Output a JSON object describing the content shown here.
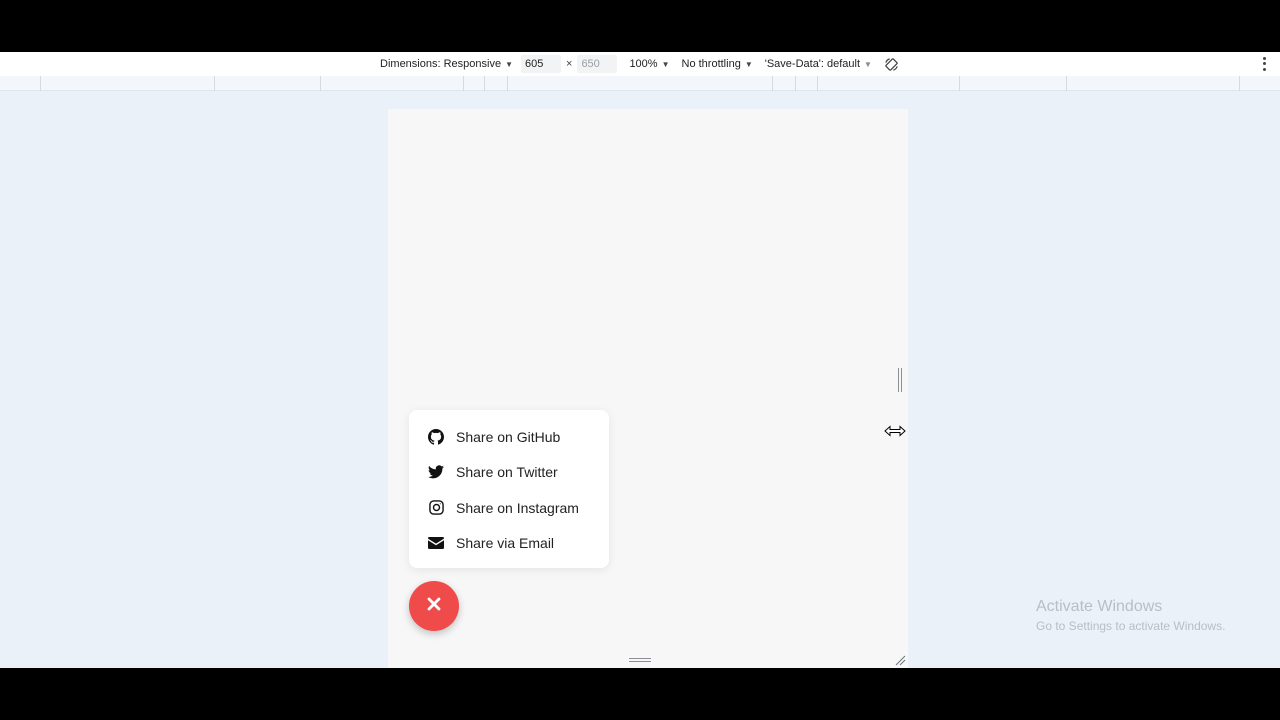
{
  "toolbar": {
    "dimensions_label": "Dimensions: Responsive",
    "width_value": "605",
    "height_value": "650",
    "times": "×",
    "zoom": "100%",
    "throttling": "No throttling",
    "save_data": "'Save-Data': default"
  },
  "share_menu": {
    "items": [
      {
        "label": "Share on GitHub",
        "icon": "github-icon"
      },
      {
        "label": "Share on Twitter",
        "icon": "twitter-icon"
      },
      {
        "label": "Share on Instagram",
        "icon": "instagram-icon"
      },
      {
        "label": "Share via Email",
        "icon": "email-icon"
      }
    ]
  },
  "fab": {
    "icon": "close-icon",
    "color": "#ef4b4b"
  },
  "watermark": {
    "title": "Activate Windows",
    "subtitle": "Go to Settings to activate Windows."
  }
}
